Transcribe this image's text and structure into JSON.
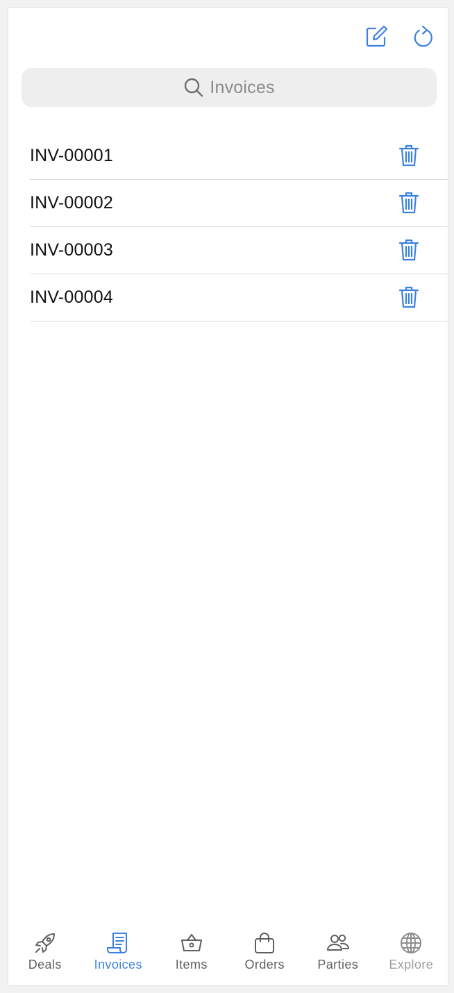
{
  "colors": {
    "accent": "#3c80e0",
    "tab_inactive": "#5f5f5f",
    "tab_dim": "#9e9e9e",
    "text": "#111111",
    "search_bg": "#eeeeee"
  },
  "toolbar": {
    "compose_icon": "compose-icon",
    "refresh_icon": "refresh-icon"
  },
  "search": {
    "icon": "search-icon",
    "placeholder": "Invoices"
  },
  "invoices": [
    {
      "label": "INV-00001",
      "action_icon": "trash-icon"
    },
    {
      "label": "INV-00002",
      "action_icon": "trash-icon"
    },
    {
      "label": "INV-00003",
      "action_icon": "trash-icon"
    },
    {
      "label": "INV-00004",
      "action_icon": "trash-icon"
    }
  ],
  "tabs": [
    {
      "label": "Deals",
      "icon": "rocket-icon",
      "state": "inactive"
    },
    {
      "label": "Invoices",
      "icon": "receipt-icon",
      "state": "active"
    },
    {
      "label": "Items",
      "icon": "basket-icon",
      "state": "inactive"
    },
    {
      "label": "Orders",
      "icon": "shopping-bag-icon",
      "state": "inactive"
    },
    {
      "label": "Parties",
      "icon": "people-icon",
      "state": "inactive"
    },
    {
      "label": "Explore",
      "icon": "globe-icon",
      "state": "dim"
    }
  ]
}
